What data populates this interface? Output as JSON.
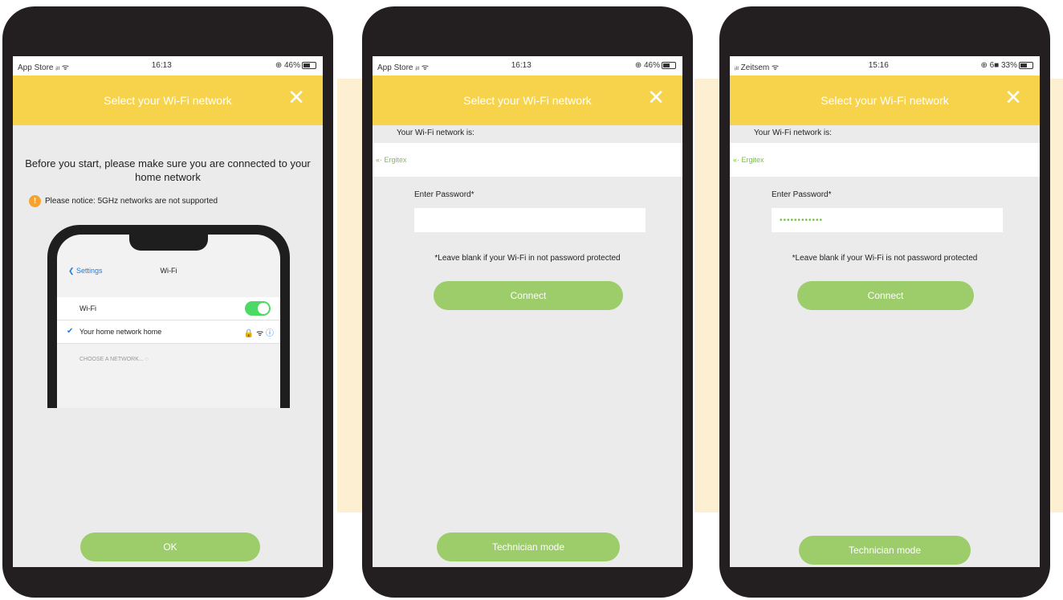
{
  "screens": [
    {
      "status": {
        "carrier": "App Store ᵢₗₗ ᯤ",
        "time": "16:13",
        "battery": "⊕ 46%"
      },
      "header": {
        "title": "Select your Wi-Fi network",
        "close": "✕"
      },
      "notice": {
        "heading": "Before you start, please make sure you are connected to your home network",
        "warning": "Please notice: 5GHz networks are not supported"
      },
      "illustration": {
        "back": "❮ Settings",
        "title": "Wi-Fi",
        "wifi_label": "Wi-Fi",
        "network_name": "Your home network home",
        "row_icons": "🔒 ᯤ",
        "section": "CHOOSE A NETWORK... ◌"
      },
      "button": "OK"
    },
    {
      "status": {
        "carrier": "App Store ᵢₗₗ ᯤ",
        "time": "16:13",
        "battery": "⊕ 46%"
      },
      "header": {
        "title": "Select your Wi-Fi network",
        "close": "✕"
      },
      "network_label": "Your Wi-Fi network is:",
      "network_value": "«· Ergitex",
      "password_label": "Enter Password*",
      "password_value": "",
      "hint": "*Leave blank if your Wi-Fi in not password protected",
      "connect": "Connect",
      "tech": "Technician mode"
    },
    {
      "status": {
        "carrier": "ᵢₗₗ Zeitsem ᯤ",
        "time": "15:16",
        "battery": "⊕ 6■ 33%"
      },
      "header": {
        "title": "Select your Wi-Fi network",
        "close": "✕"
      },
      "network_label": "Your Wi-Fi network is:",
      "network_value": "«· Ergitex",
      "password_label": "Enter Password*",
      "password_value": "••••••••••••",
      "hint": "*Leave blank if your Wi-Fi is not password protected",
      "connect": "Connect",
      "tech": "Technician mode"
    }
  ],
  "colors": {
    "header": "#f6d34b",
    "button": "#9dcc6a",
    "frame": "#231f20",
    "screen_bg": "#ebebeb",
    "backdrop": "#fdf0d2",
    "network_text": "#7ac04a"
  }
}
